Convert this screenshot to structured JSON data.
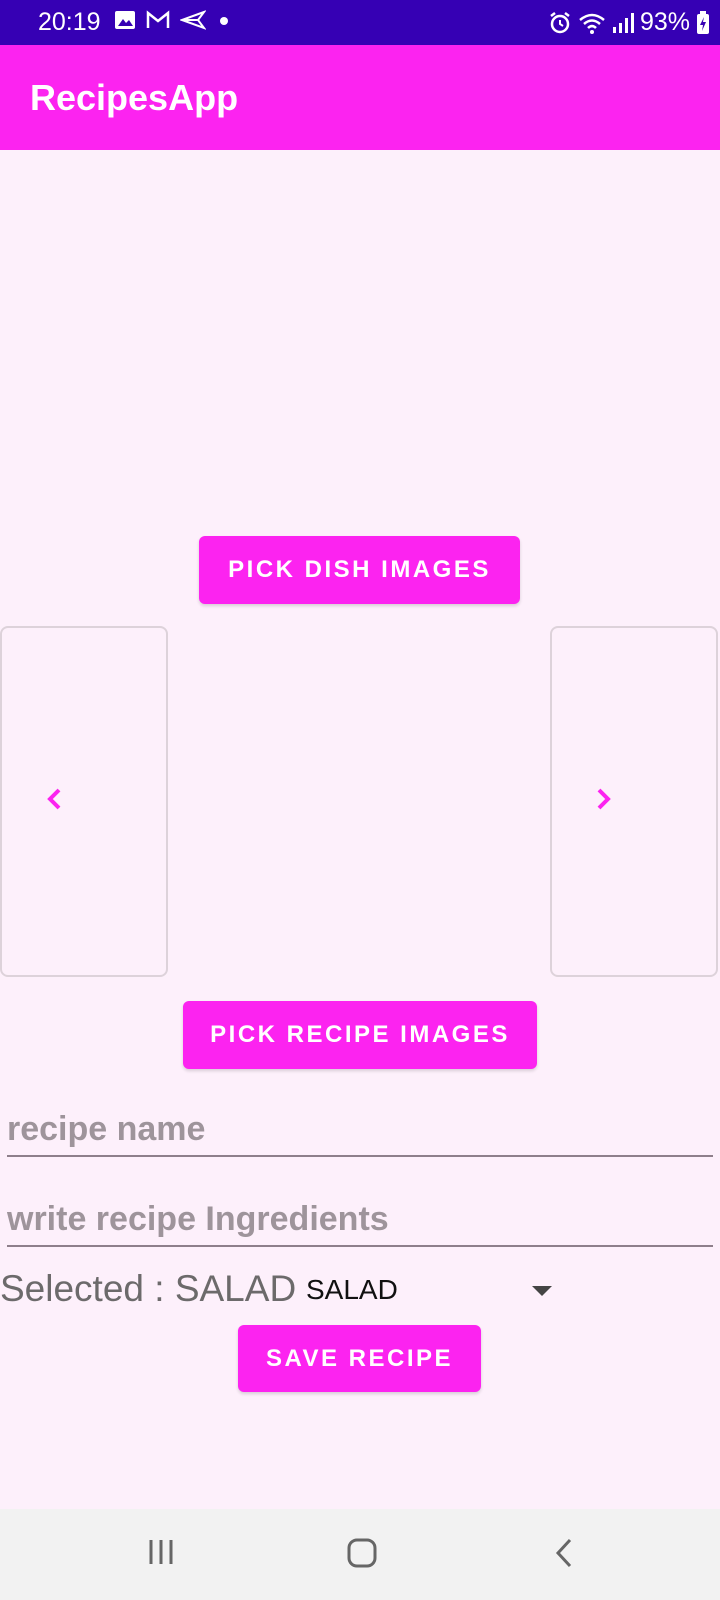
{
  "status_bar": {
    "time": "20:19",
    "battery": "93%",
    "left_icons": [
      "gallery-icon",
      "gmail-icon",
      "send-icon",
      "dot-icon"
    ],
    "right_icons": [
      "alarm-icon",
      "wifi-icon",
      "signal-icon",
      "battery-charging-icon"
    ]
  },
  "app_bar": {
    "title": "RecipesApp"
  },
  "buttons": {
    "pick_dish": "PICK DISH IMAGES",
    "pick_recipe": "PICK RECIPE IMAGES",
    "save": "SAVE RECIPE"
  },
  "carousel": {
    "prev_icon": "chevron-left-icon",
    "next_icon": "chevron-right-icon"
  },
  "form": {
    "recipe_name_placeholder": "recipe name",
    "ingredients_placeholder": "write recipe Ingredients",
    "selected_label": "Selected : SALAD",
    "category_value": "SALAD"
  },
  "nav_bar": {
    "icons": [
      "recents-icon",
      "home-icon",
      "back-icon"
    ]
  },
  "colors": {
    "status_bar": "#3600b4",
    "accent": "#fc23f0",
    "background": "#fdf0fb",
    "nav_bar": "#f2f2f2"
  }
}
